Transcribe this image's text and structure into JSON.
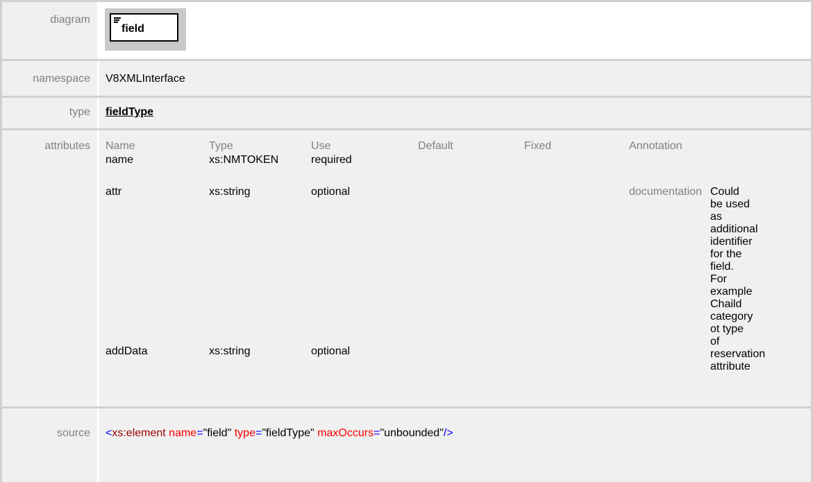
{
  "diagram": {
    "label": "diagram",
    "element_name": "field"
  },
  "namespace": {
    "label": "namespace",
    "value": "V8XMLInterface"
  },
  "type": {
    "label": "type",
    "value": "fieldType"
  },
  "attributes": {
    "label": "attributes",
    "headers": [
      "Name",
      "Type",
      "Use",
      "Default",
      "Fixed",
      "Annotation"
    ],
    "rows": [
      {
        "name": "name",
        "type": "xs:NMTOKEN",
        "use": "required",
        "default": "",
        "fixed": "",
        "annotation_label": "",
        "annotation_text": ""
      },
      {
        "name": "attr",
        "type": "xs:string",
        "use": "optional",
        "default": "",
        "fixed": "",
        "annotation_label": "documentation",
        "annotation_text": "Could be used as additional identifier for the field. For example Chaild category ot type of reservation attribute"
      },
      {
        "name": "addData",
        "type": "xs:string",
        "use": "optional",
        "default": "",
        "fixed": "",
        "annotation_label": "",
        "annotation_text": ""
      }
    ]
  },
  "source": {
    "label": "source",
    "code": {
      "open": "<",
      "tag": "xs:element",
      "attr1": "name",
      "eq1": "=",
      "val1": "\"field\"",
      "attr2": "type",
      "eq2": "=",
      "val2": "\"fieldType\"",
      "attr3": "maxOccurs",
      "eq3": "=",
      "val3": "\"unbounded\"",
      "close": "/>"
    }
  },
  "colors": {
    "label_bg": "#f0f0f0",
    "border": "#d0d0d0",
    "label_text": "#808080",
    "tag": "#990000",
    "attr_name": "#ff0000",
    "punctuation": "#0000ff"
  }
}
